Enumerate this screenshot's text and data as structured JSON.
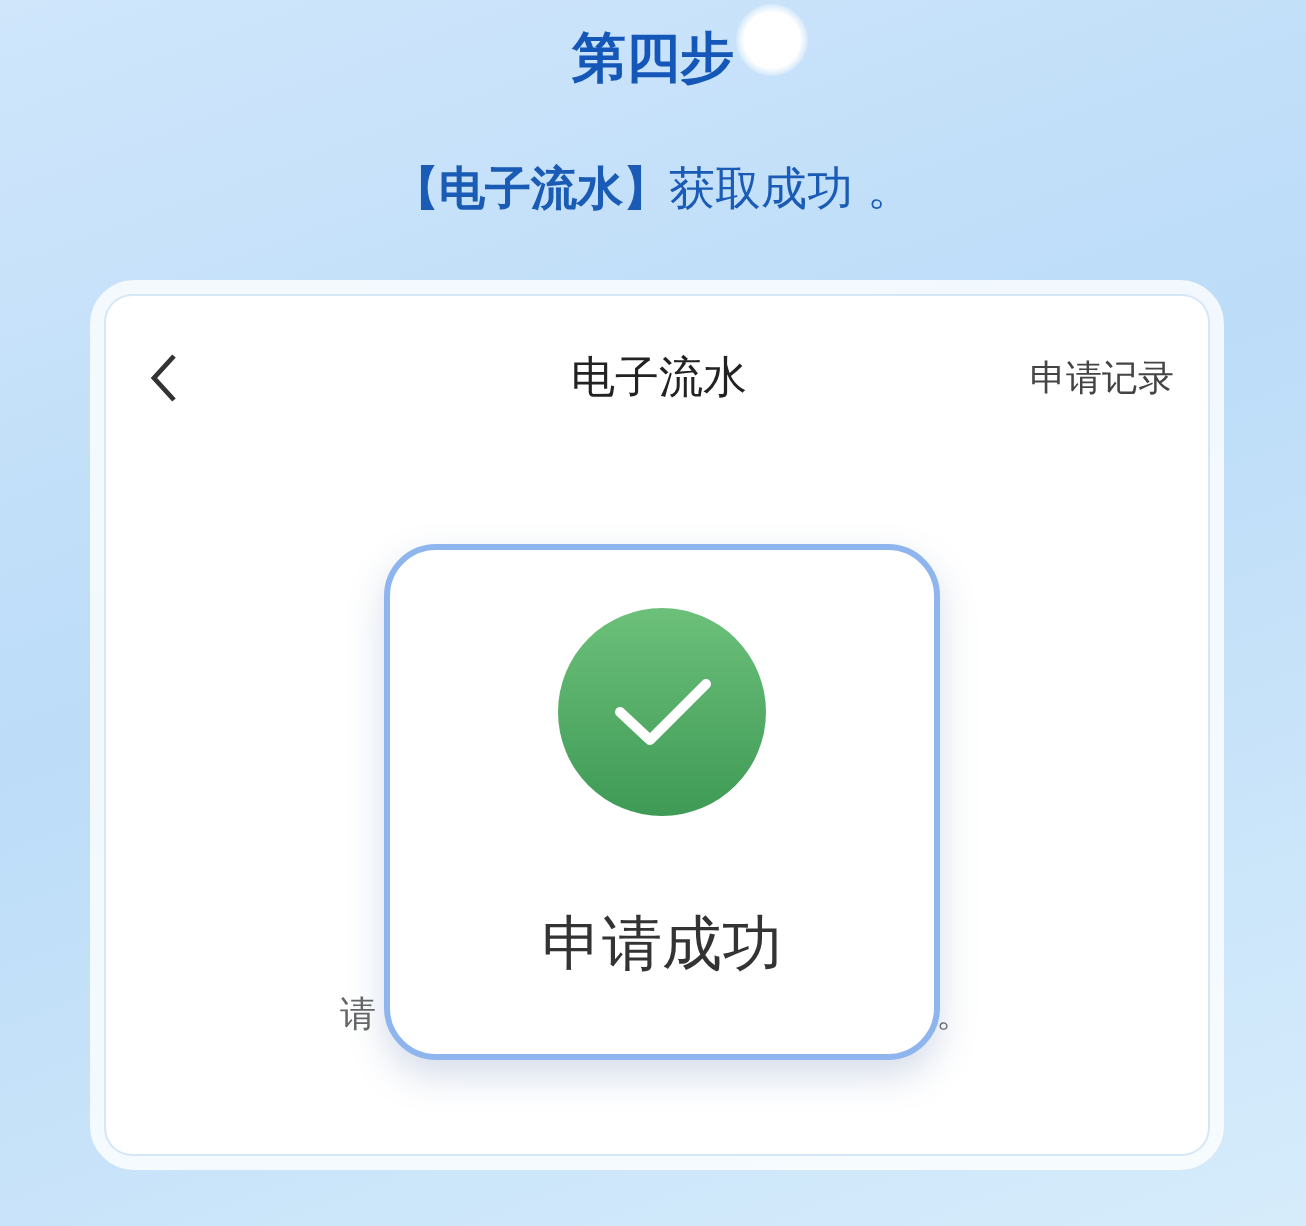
{
  "step": {
    "title": "第四步",
    "subtitle": "**【电子流水】**获取成功 。"
  },
  "screen": {
    "title": "电子流水",
    "action": "申请记录",
    "hidden_text_start": "请",
    "hidden_text_end": "。"
  },
  "dialog": {
    "message": "申请成功"
  }
}
